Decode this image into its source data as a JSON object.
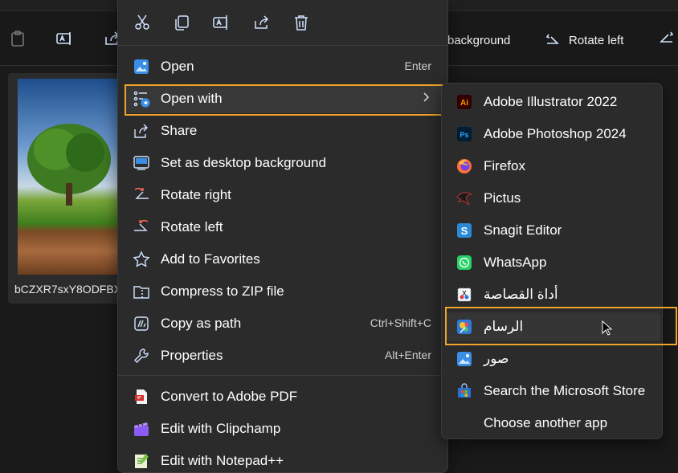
{
  "toolbar": {
    "set_background_label": "background",
    "rotate_left_label": "Rotate left"
  },
  "file": {
    "name": "bCZXR7sxY8ODFBX"
  },
  "context_menu": {
    "quick_actions": [
      "cut-icon",
      "copy-icon",
      "rename-icon",
      "share-icon",
      "delete-icon"
    ],
    "items": [
      {
        "label": "Open",
        "shortcut": "Enter",
        "icon": "photos-icon"
      },
      {
        "label": "Open with",
        "icon": "open-with-icon",
        "submenu": true
      },
      {
        "label": "Share",
        "icon": "share-icon"
      },
      {
        "label": "Set as desktop background",
        "icon": "desktop-background-icon"
      },
      {
        "label": "Rotate right",
        "icon": "rotate-right-icon"
      },
      {
        "label": "Rotate left",
        "icon": "rotate-left-icon"
      },
      {
        "label": "Add to Favorites",
        "icon": "star-icon"
      },
      {
        "label": "Compress to ZIP file",
        "icon": "zip-icon"
      },
      {
        "label": "Copy as path",
        "shortcut": "Ctrl+Shift+C",
        "icon": "copy-path-icon"
      },
      {
        "label": "Properties",
        "shortcut": "Alt+Enter",
        "icon": "wrench-icon"
      },
      {
        "label": "Convert to Adobe PDF",
        "icon": "adobe-pdf-icon"
      },
      {
        "label": "Edit with Clipchamp",
        "icon": "clipchamp-icon"
      },
      {
        "label": "Edit with Notepad++",
        "icon": "notepadpp-icon"
      }
    ]
  },
  "open_with_menu": {
    "items": [
      {
        "label": "Adobe Illustrator 2022",
        "icon": "illustrator-icon",
        "badge": "Ai"
      },
      {
        "label": "Adobe Photoshop 2024",
        "icon": "photoshop-icon",
        "badge": "Ps"
      },
      {
        "label": "Firefox",
        "icon": "firefox-icon"
      },
      {
        "label": "Pictus",
        "icon": "pictus-icon"
      },
      {
        "label": "Snagit Editor",
        "icon": "snagit-icon",
        "badge": "S"
      },
      {
        "label": "WhatsApp",
        "icon": "whatsapp-icon"
      },
      {
        "label": "أداة القصاصة",
        "icon": "snipping-tool-icon"
      },
      {
        "label": "الرسام",
        "icon": "paint-icon"
      },
      {
        "label": "صور",
        "icon": "photos-icon"
      },
      {
        "label": "Search the Microsoft Store",
        "icon": "store-icon"
      },
      {
        "label": "Choose another app",
        "icon": ""
      }
    ]
  },
  "colors": {
    "highlight": "#f0a52a",
    "menu_bg": "#2b2b2b",
    "selection": "#383838"
  }
}
